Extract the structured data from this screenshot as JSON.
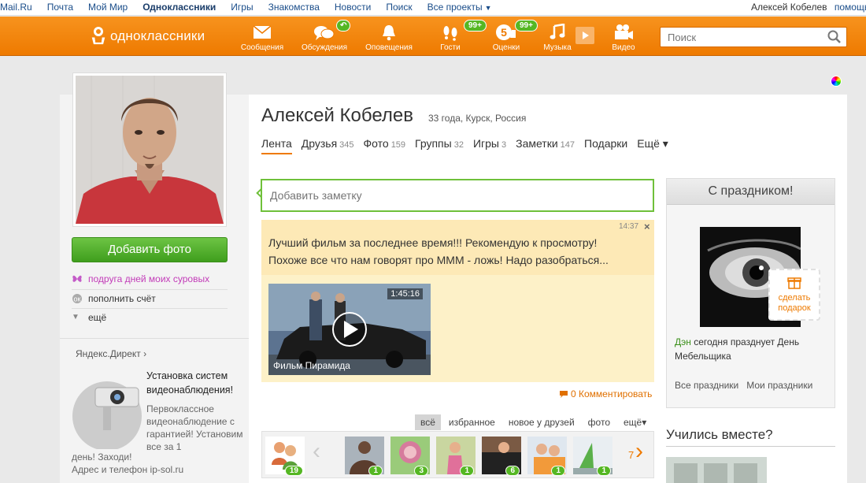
{
  "topbar": {
    "links": [
      "Mail.Ru",
      "Почта",
      "Мой Мир",
      "Одноклассники",
      "Игры",
      "Знакомства",
      "Новости",
      "Поиск",
      "Все проекты"
    ],
    "user_name": "Алексей Кобелев",
    "logout": "помощь"
  },
  "nav": {
    "logo": "одноклассники",
    "items": [
      {
        "label": "Сообщения",
        "icon": "envelope-icon"
      },
      {
        "label": "Обсуждения",
        "icon": "chat-bubbles-icon"
      },
      {
        "label": "Оповещения",
        "icon": "bell-icon"
      },
      {
        "label": "Гости",
        "icon": "footprints-icon",
        "badge": "99+"
      },
      {
        "label": "Оценки",
        "icon": "rating-icon",
        "badge": "99+"
      },
      {
        "label": "Музыка",
        "icon": "music-note-icon"
      },
      {
        "label": "Видео",
        "icon": "video-camera-icon"
      }
    ],
    "search_placeholder": "Поиск",
    "accent": "#f7931e"
  },
  "sidebar": {
    "add_photo": "Добавить фото",
    "links": [
      "подруга дней моих суровых",
      "пополнить счёт",
      "ещё"
    ],
    "direct_label": "Яндекс.Директ ›",
    "ad_title": "Установка систем видеонаблюдения!",
    "ad_desc": "Первоклассное видеонаблюдение с гарантией! Установим все за 1",
    "ad_desc2_line1": "день! Заходи!",
    "ad_desc2_line2": "Адрес и телефон ip-sol.ru"
  },
  "profile": {
    "name": "Алексей Кобелев",
    "meta": "33 года, Курск, Россия",
    "tabs": [
      {
        "label": "Лента",
        "count": ""
      },
      {
        "label": "Друзья",
        "count": "345"
      },
      {
        "label": "Фото",
        "count": "159"
      },
      {
        "label": "Группы",
        "count": "32"
      },
      {
        "label": "Игры",
        "count": "3"
      },
      {
        "label": "Заметки",
        "count": "147"
      },
      {
        "label": "Подарки",
        "count": ""
      },
      {
        "label": "Ещё ▾",
        "count": ""
      }
    ]
  },
  "feed": {
    "note_placeholder": "Добавить заметку",
    "post_time": "14:37",
    "post_close": "×",
    "post_text_line1": "Лучший фильм за последнее время!!! Рекомендую к просмотру!",
    "post_text_line2": "Похоже все что нам говорят про МММ - ложь! Надо разобраться...",
    "video_duration": "1:45:16",
    "video_title": "Фильм Пирамида",
    "comment": "0 Комментировать",
    "filters": [
      "всё",
      "избранное",
      "новое у друзей",
      "фото",
      "ещё▾"
    ],
    "strip_badges": [
      "19",
      "1",
      "3",
      "1",
      "6",
      "1",
      "1"
    ],
    "strip_more": "7"
  },
  "holiday": {
    "title": "С праздником!",
    "gift_label": "сделать подарок",
    "who": "Дэн",
    "text": " сегодня празднует День Мебельщика",
    "links": [
      "Все праздники",
      "Мои праздники"
    ]
  },
  "studied": {
    "title": "Учились вместе?"
  }
}
